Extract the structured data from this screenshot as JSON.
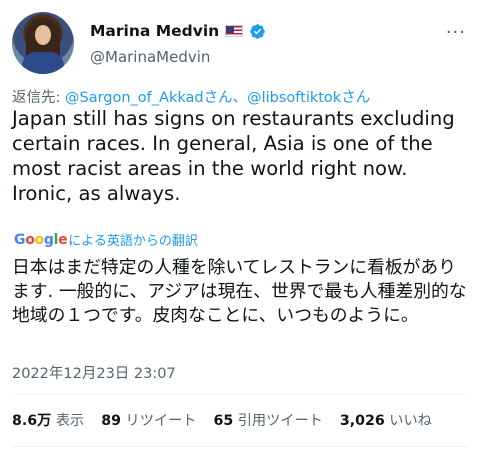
{
  "author": {
    "display_name": "Marina Medvin",
    "flag_icon": "us-flag-icon",
    "verified_icon": "verified-badge-icon",
    "handle": "@MarinaMedvin"
  },
  "reply": {
    "prefix": "返信先: ",
    "mention1": "@Sargon_of_Akkad",
    "san1": "さん、",
    "mention2": "@libsoftiktok",
    "san2": "さん"
  },
  "tweet": {
    "text": "Japan still has signs on restaurants excluding certain races. In general, Asia is one of the most racist areas in the world right now. Ironic, as always."
  },
  "translate": {
    "brand": "Google",
    "label": "による英語からの翻訳"
  },
  "translation": {
    "text": "日本はまだ特定の人種を除いてレストランに看板があります. 一般的に、アジアは現在、世界で最も人種差別的な地域の１つです。皮肉なことに、いつものように。"
  },
  "timestamp": "2022年12月23日 23:07",
  "stats": {
    "views_num": "8.6万",
    "views_label": "表示",
    "retweets_num": "89",
    "retweets_label": "リツイート",
    "quotes_num": "65",
    "quotes_label": "引用ツイート",
    "likes_num": "3,026",
    "likes_label": "いいね"
  },
  "colors": {
    "link": "#1d9bf0",
    "secondary_text": "#536471",
    "primary_text": "#0f1419"
  }
}
